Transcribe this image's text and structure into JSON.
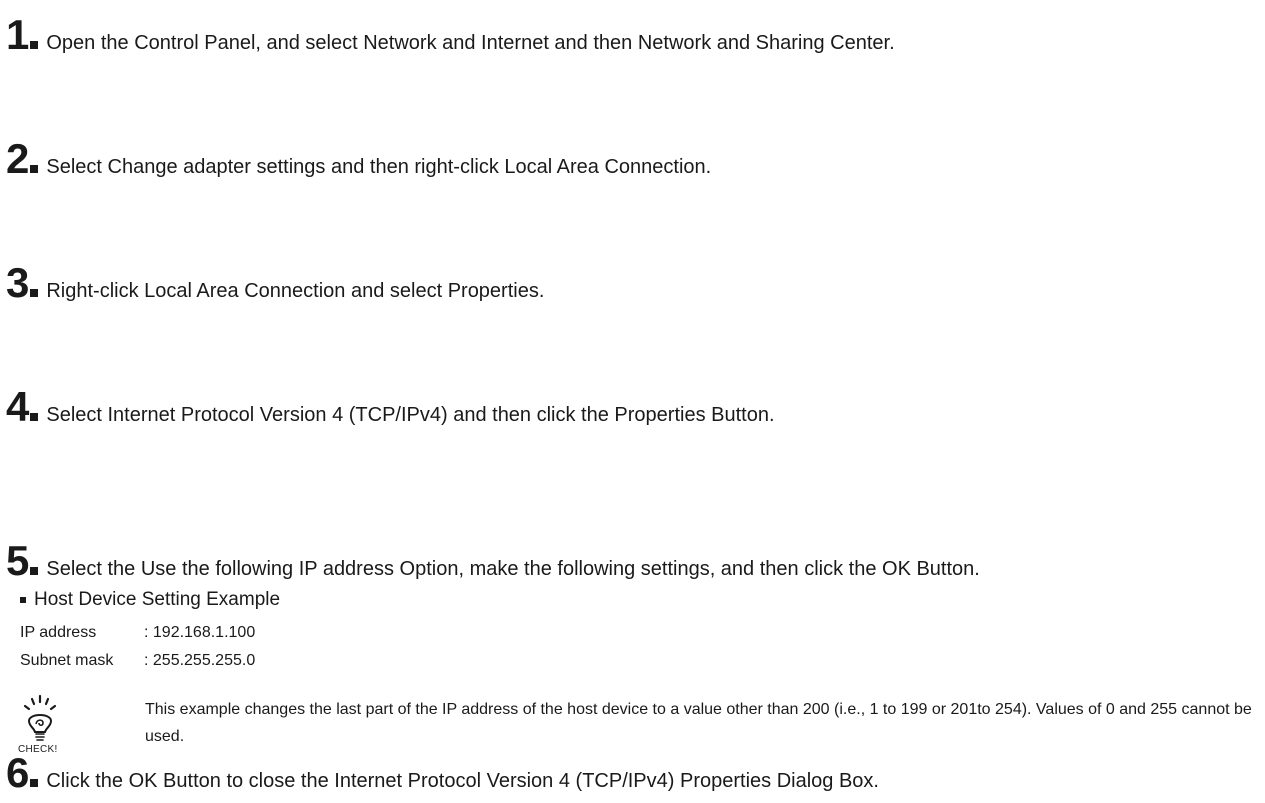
{
  "steps": [
    {
      "num": "1",
      "text": "Open the Control Panel, and select Network and Internet and then Network and Sharing Center."
    },
    {
      "num": "2",
      "text": "Select Change adapter settings and then right-click Local Area Connection."
    },
    {
      "num": "3",
      "text": "Right-click Local Area Connection and select Properties."
    },
    {
      "num": "4",
      "text": "Select Internet Protocol Version 4 (TCP/IPv4) and then click the Properties Button."
    },
    {
      "num": "5",
      "text": "Select the Use the following IP address Option, make the following settings, and then click the OK Button."
    },
    {
      "num": "6",
      "text": "Click the OK Button to close the Internet Protocol Version 4 (TCP/IPv4) Properties Dialog Box."
    }
  ],
  "example": {
    "heading": "Host Device Setting Example",
    "rows": [
      {
        "key": "IP address",
        "value": ": 192.168.1.100"
      },
      {
        "key": "Subnet mask",
        "value": ": 255.255.255.0"
      }
    ]
  },
  "check": {
    "label": "CHECK!",
    "icon": "lightbulb-icon",
    "text": "This example changes the last part of the IP address of the host device to a value other than 200 (i.e., 1 to 199 or 201to 254). Values of 0 and 255 cannot be used."
  }
}
